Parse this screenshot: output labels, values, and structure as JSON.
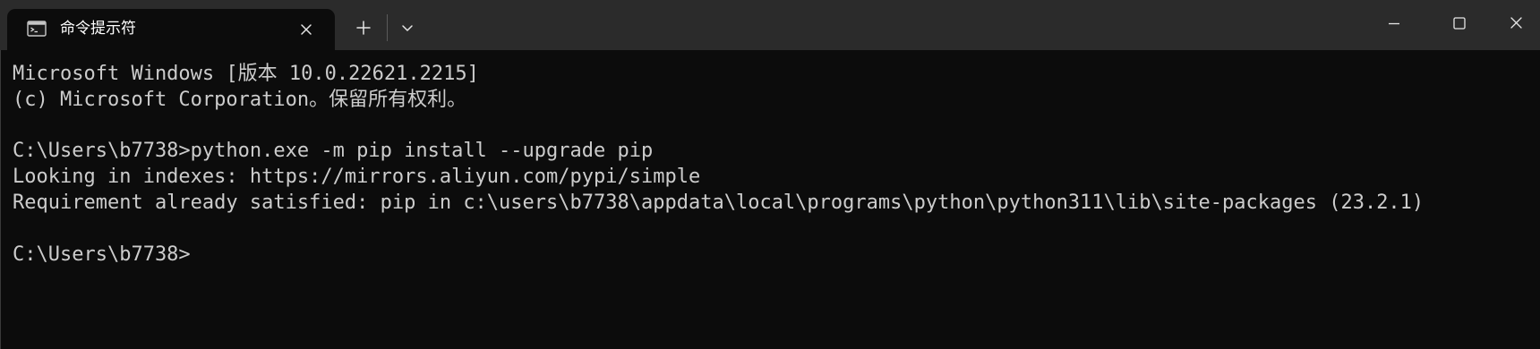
{
  "window": {
    "tab_title": "命令提示符",
    "tab_icon": "cmd-icon",
    "buttons": {
      "close_tab": "close-icon",
      "new_tab": "plus-icon",
      "dropdown": "chevron-down-icon",
      "minimize": "minimize-icon",
      "maximize": "maximize-icon",
      "close_window": "close-icon"
    }
  },
  "terminal": {
    "lines": [
      "Microsoft Windows [版本 10.0.22621.2215]",
      "(c) Microsoft Corporation。保留所有权利。",
      "",
      "C:\\Users\\b7738>python.exe -m pip install --upgrade pip",
      "Looking in indexes: https://mirrors.aliyun.com/pypi/simple",
      "Requirement already satisfied: pip in c:\\users\\b7738\\appdata\\local\\programs\\python\\python311\\lib\\site-packages (23.2.1)",
      "",
      "C:\\Users\\b7738>"
    ]
  },
  "colors": {
    "titlebar_bg": "#2b2b2b",
    "terminal_bg": "#0c0c0c",
    "terminal_text": "#cccccc"
  }
}
